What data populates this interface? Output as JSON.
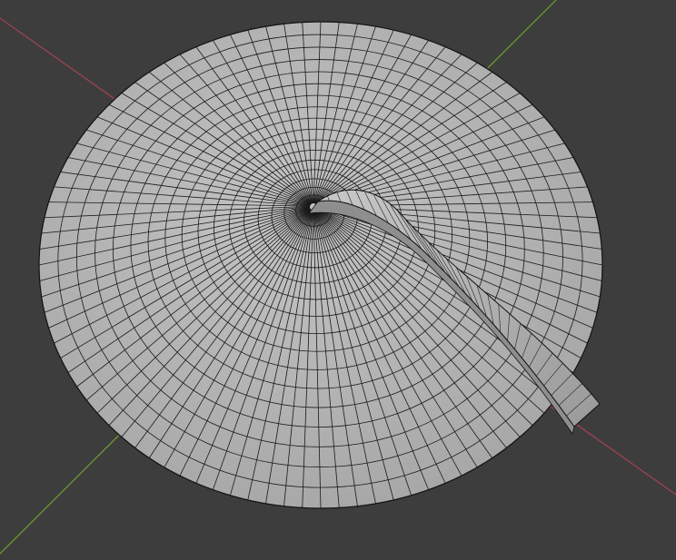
{
  "viewport": {
    "background_color": "#3d3d3d",
    "x_axis_color": "#a0424f",
    "y_axis_color": "#6a9a2e",
    "mesh_color": "#b4b4b4",
    "wire_color": "#1a1a1a"
  },
  "mesh": {
    "object": "disk",
    "radial_segments": 96,
    "rings": 18,
    "ribbon": true
  }
}
